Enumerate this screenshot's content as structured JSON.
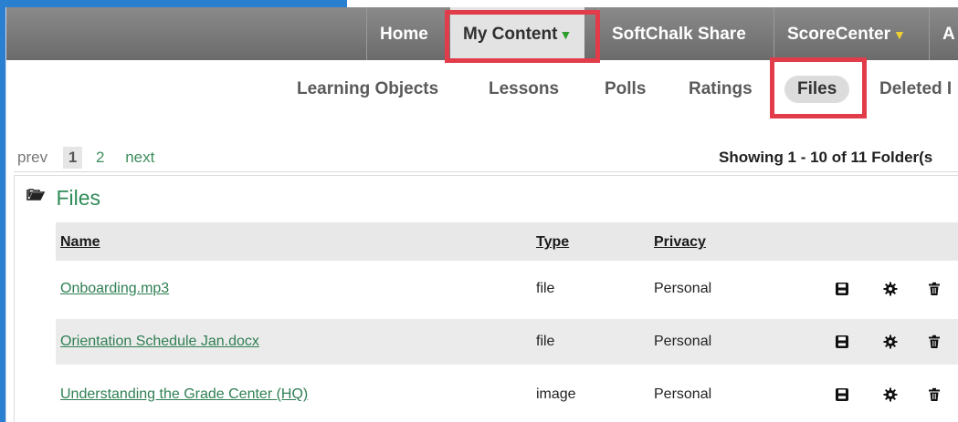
{
  "topnav": {
    "items": [
      {
        "label": "Home"
      },
      {
        "label": "My Content",
        "active": true
      },
      {
        "label": "SoftChalk Share"
      },
      {
        "label": "ScoreCenter"
      },
      {
        "label": "A"
      }
    ]
  },
  "subnav": {
    "items": [
      {
        "label": "Learning Objects"
      },
      {
        "label": "Lessons"
      },
      {
        "label": "Polls"
      },
      {
        "label": "Ratings"
      },
      {
        "label": "Files",
        "active": true
      },
      {
        "label": "Deleted I"
      }
    ]
  },
  "pagination": {
    "prev": "prev",
    "current": "1",
    "page2": "2",
    "next": "next",
    "showing": "Showing 1 - 10 of 11 Folder(s"
  },
  "section": {
    "title": "Files"
  },
  "table": {
    "headers": {
      "name": "Name",
      "type": "Type",
      "privacy": "Privacy"
    },
    "rows": [
      {
        "name": "Onboarding.mp3",
        "type": "file",
        "privacy": "Personal"
      },
      {
        "name": "Orientation Schedule Jan.docx",
        "type": "file",
        "privacy": "Personal"
      },
      {
        "name": "Understanding the Grade Center (HQ)",
        "type": "image",
        "privacy": "Personal"
      }
    ]
  },
  "icons": {
    "save": "save-icon",
    "settings": "gear-icon",
    "delete": "trash-icon",
    "folder": "folder-open-icon"
  },
  "colors": {
    "topbar": "#7a7a7a",
    "accent_green": "#2f8b57",
    "highlight": "#e23b4a",
    "frame": "#2a7fd0"
  }
}
